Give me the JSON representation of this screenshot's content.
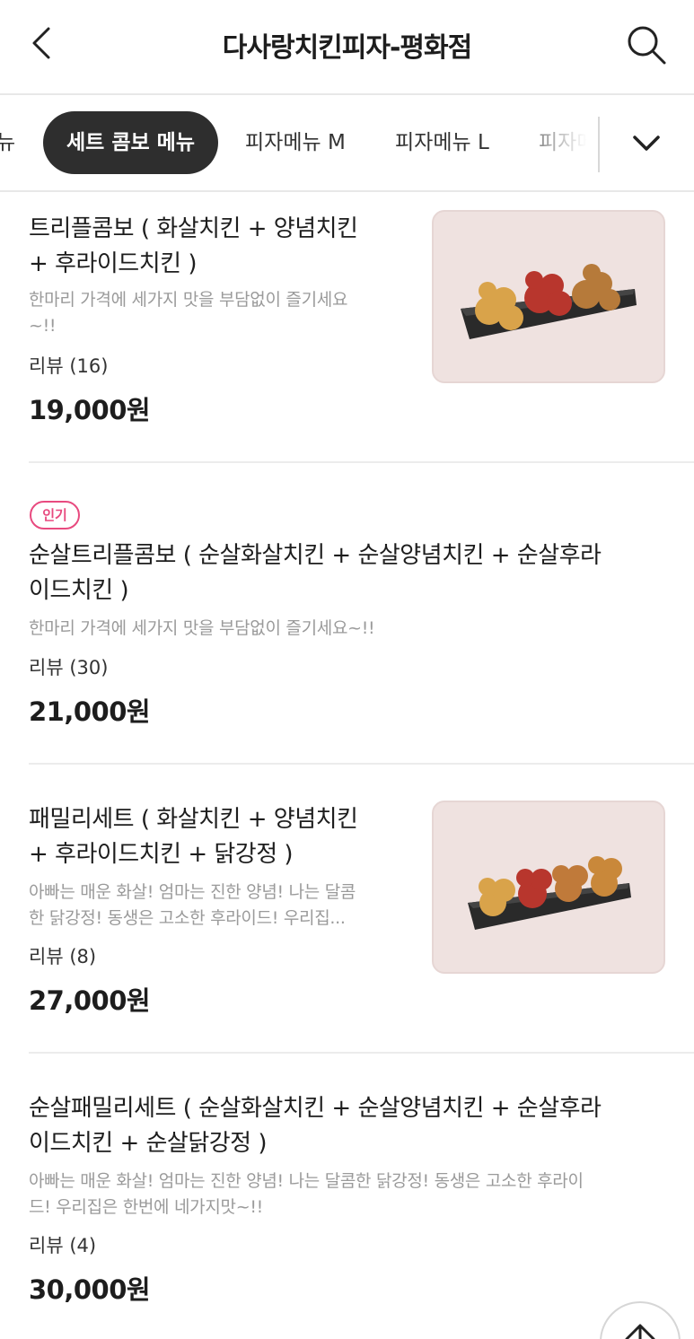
{
  "header": {
    "title": "다사랑치킨피자-평화점",
    "back_icon": "chevron-left-icon",
    "search_icon": "search-icon"
  },
  "tabs": [
    {
      "label": "뉴",
      "active": false
    },
    {
      "label": "세트 콤보 메뉴",
      "active": true
    },
    {
      "label": "피자메뉴 M",
      "active": false
    },
    {
      "label": "피자메뉴 L",
      "active": false
    },
    {
      "label": "피자메",
      "active": false
    }
  ],
  "tab_more_icon": "chevron-down-icon",
  "items": [
    {
      "badge": "",
      "name_lines": [
        "트리플콤보 ( 화살치킨 + 양념치킨",
        "+ 후라이드치킨 )"
      ],
      "desc_lines": [
        "한마리 가격에 세가지 맛을 부담없이 즐기세요",
        "~!!"
      ],
      "review": "리뷰 (16)",
      "price": "19,000원",
      "has_image": true
    },
    {
      "badge": "인기",
      "name_lines": [
        "순살트리플콤보 ( 순살화살치킨 + 순살양념치킨 + 순살후라",
        "이드치킨 )"
      ],
      "desc_lines": [
        "한마리 가격에 세가지 맛을 부담없이 즐기세요~!!"
      ],
      "review": "리뷰 (30)",
      "price": "21,000원",
      "has_image": false
    },
    {
      "badge": "",
      "name_lines": [
        "패밀리세트 ( 화살치킨 + 양념치킨",
        "+ 후라이드치킨 + 닭강정 )"
      ],
      "desc_lines": [
        "아빠는 매운 화살! 엄마는 진한 양념! 나는 달콤",
        "한 닭강정! 동생은 고소한 후라이드! 우리집..."
      ],
      "review": "리뷰 (8)",
      "price": "27,000원",
      "has_image": true
    },
    {
      "badge": "",
      "name_lines": [
        "순살패밀리세트 ( 순살화살치킨 + 순살양념치킨 + 순살후라",
        "이드치킨 + 순살닭강정 )"
      ],
      "desc_lines": [
        "아빠는 매운 화살! 엄마는 진한 양념! 나는 달콤한 닭강정! 동생은 고소한 후라이",
        "드! 우리집은 한번에 네가지맛~!!"
      ],
      "review": "리뷰 (4)",
      "price": "30,000원",
      "has_image": false
    }
  ],
  "scroll_top_icon": "arrow-up-icon",
  "colors": {
    "accent_pink": "#e84a7f",
    "active_tab_bg": "#2e2e2e",
    "thumb_bg": "#efe2e0"
  }
}
